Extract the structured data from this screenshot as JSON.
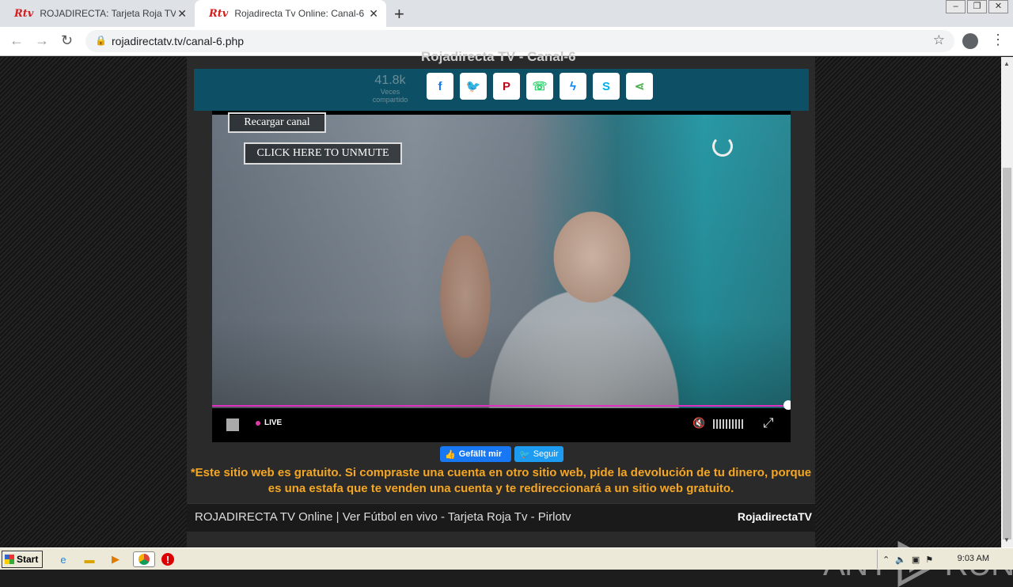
{
  "browser": {
    "tabs": [
      {
        "favicon": "Rtv",
        "title": "ROJADIRECTA: Tarjeta Roja TV - Pir",
        "active": false
      },
      {
        "favicon": "Rtv",
        "title": "Rojadirecta Tv Online: Canal-6",
        "active": true
      }
    ],
    "new_tab_icon": "+",
    "url": "rojadirectatv.tv/canal-6.php"
  },
  "page": {
    "heading": "Rojadirecta TV - Canal-6",
    "share": {
      "count": "41.8k",
      "count_label": "Veces compartido",
      "buttons": [
        "facebook-icon",
        "twitter-icon",
        "pinterest-icon",
        "whatsapp-icon",
        "messenger-icon",
        "skype-icon",
        "share-icon"
      ],
      "colors": {
        "facebook": "#1877f2",
        "twitter": "#1da1f2",
        "pinterest": "#bd081c",
        "whatsapp": "#25d366",
        "messenger": "#0084ff",
        "skype": "#00aff0",
        "share": "#4caf50"
      }
    },
    "player": {
      "reload_label": "Recargar canal",
      "unmute_label": "CLICK HERE TO UNMUTE",
      "live_label": "LIVE"
    },
    "social": {
      "like_label": "Gefällt mir",
      "follow_label": "Seguir"
    },
    "notice": "*Este sitio web es gratuito. Si compraste una cuenta en otro sitio web, pide la devolución de tu dinero, porque es una estafa que te venden una cuenta y te redireccionará a un sitio web gratuito.",
    "footer": {
      "text": "ROJADIRECTA TV Online | Ver Fútbol en vivo - Tarjeta Roja Tv - Pirlotv",
      "brand": "RojadirectaTV"
    },
    "watermark": {
      "left": "ANY",
      "right": "RUN"
    }
  },
  "taskbar": {
    "start_label": "Start",
    "clock": "9:03 AM"
  }
}
